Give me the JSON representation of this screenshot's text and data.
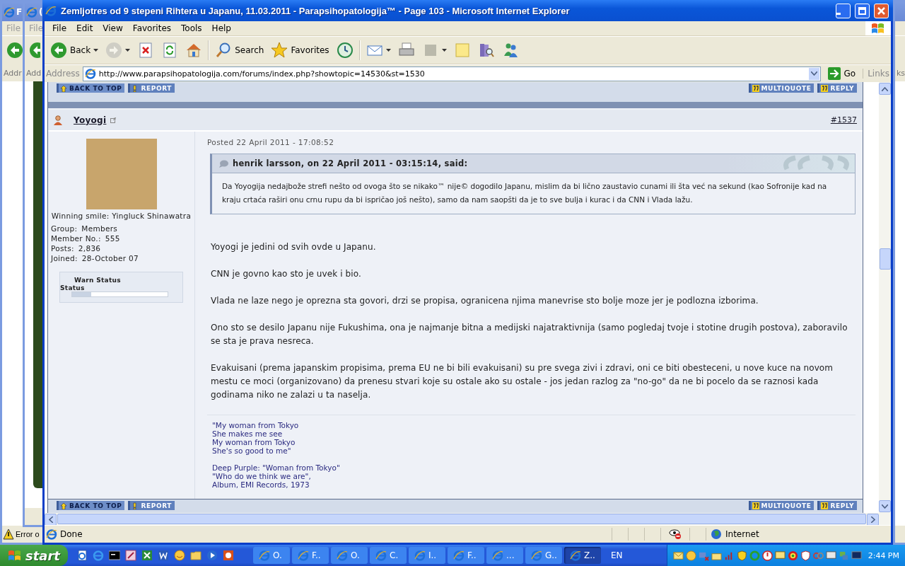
{
  "background_windows": [
    {
      "title": "F",
      "menu": "File",
      "address": "Addr",
      "status": "Error o"
    },
    {
      "title": "(",
      "menu": "File",
      "address": "Add"
    },
    {
      "links": "ks"
    }
  ],
  "window": {
    "title": "Zemljotres od 9 stepeni Rihtera u Japanu, 11.03.2011 - Parapsihopatologija™ - Page 103 - Microsoft Internet Explorer"
  },
  "menu": [
    "File",
    "Edit",
    "View",
    "Favorites",
    "Tools",
    "Help"
  ],
  "toolbar": [
    {
      "kind": "back",
      "label": "Back",
      "dropdown": true,
      "disabled": false
    },
    {
      "kind": "forward",
      "dropdown": true,
      "disabled": true
    },
    {
      "kind": "stop",
      "dropdown": false,
      "disabled": false
    },
    {
      "kind": "refresh",
      "dropdown": false,
      "disabled": false
    },
    {
      "kind": "home",
      "dropdown": false,
      "disabled": false
    },
    {
      "kind": "search",
      "label": "Search",
      "dropdown": false,
      "disabled": false
    },
    {
      "kind": "favorites",
      "label": "Favorites",
      "dropdown": false,
      "disabled": false
    },
    {
      "kind": "history",
      "dropdown": false,
      "disabled": false
    },
    {
      "kind": "mail",
      "dropdown": true,
      "disabled": false
    },
    {
      "kind": "print",
      "dropdown": false,
      "disabled": false
    },
    {
      "kind": "edit",
      "dropdown": true,
      "disabled": true
    },
    {
      "kind": "notes",
      "dropdown": false,
      "disabled": false
    },
    {
      "kind": "research",
      "dropdown": false,
      "disabled": false
    },
    {
      "kind": "messenger",
      "dropdown": false,
      "disabled": false
    }
  ],
  "address": {
    "label": "Address",
    "url": "http://www.parapsihopatologija.com/forums/index.php?showtopic=14530&st=1530",
    "go": "Go",
    "links": "Links"
  },
  "post": {
    "top_buttons": [
      {
        "kind": "top",
        "label": "BACK TO TOP"
      },
      {
        "kind": "report",
        "label": "REPORT"
      },
      {
        "kind": "quote",
        "label": "MULTIQUOTE"
      },
      {
        "kind": "quote",
        "label": "REPLY"
      }
    ],
    "author": "Yoyogi",
    "number": "#1537",
    "avatar_caption": "Winning smile: Yingluck Shinawatra",
    "profile": [
      {
        "label": "Group:",
        "value": "Members"
      },
      {
        "label": "Member No.:",
        "value": "555"
      },
      {
        "label": "Posts:",
        "value": "2,836"
      },
      {
        "label": "Joined:",
        "value": "28-October 07"
      }
    ],
    "warn": {
      "title": "Warn Status",
      "label": "Status",
      "level": 0.2
    },
    "posted": "Posted 22 April 2011 - 17:08:52",
    "quote": {
      "header": "henrik larsson, on 22 April 2011 - 03:15:14, said:",
      "text": "Da Yoyogija nedajbože strefi nešto od ovoga što se nikako™ nije© dogodilo Japanu, mislim da bi lično zaustavio cunami ili šta već na sekund (kao Sofronije kad na kraju crtaća raširi onu crnu rupu da bi ispričao još nešto), samo da nam saopšti da je to sve bulja i kurac i da CNN i Vlada lažu."
    },
    "paragraphs": [
      "Yoyogi je jedini od svih ovde u Japanu.",
      "CNN je govno kao sto je uvek i bio.",
      "Vlada ne laze nego je oprezna sta govori, drzi se propisa, ogranicena njima manevrise sto bolje moze jer je podlozna izborima.",
      "Ono sto se desilo Japanu nije Fukushima, ona je najmanje bitna a medijski najatraktivnija (samo pogledaj tvoje i stotine drugih postova), zaboravilo se sta je prava nesreca.",
      "Evakuisani (prema japanskim propisima, prema EU ne bi bili evakuisani) su pre svega zivi i zdravi, oni ce biti obesteceni, u nove kuce na novom mestu ce moci (organizovano) da prenesu stvari koje su ostale ako su ostale - jos jedan razlog za \"no-go\" da ne bi pocelo da se raznosi kada godinama niko ne zalazi u ta naselja."
    ],
    "signature": [
      {
        "lines": [
          "\"My woman from Tokyo",
          "She makes me see",
          "My woman from Tokyo",
          "She's so good to me\""
        ]
      },
      {
        "lines": [
          "Deep Purple: \"Woman from Tokyo\"",
          "\"Who do we think we are\",",
          "Album, EMI Records, 1973"
        ]
      }
    ],
    "bottom_buttons": [
      {
        "kind": "top",
        "label": "BACK TO TOP"
      },
      {
        "kind": "report",
        "label": "REPORT"
      },
      {
        "kind": "quote",
        "label": "MULTIQUOTE"
      },
      {
        "kind": "quote",
        "label": "REPLY"
      }
    ]
  },
  "status_bar": {
    "text": "Done",
    "zone": "Internet"
  },
  "taskbar": {
    "start": "start",
    "items": [
      {
        "label": "O.",
        "selected": false
      },
      {
        "label": "F..",
        "selected": false
      },
      {
        "label": "O.",
        "selected": false
      },
      {
        "label": "C.",
        "selected": false
      },
      {
        "label": "I..",
        "selected": false
      },
      {
        "label": "F..",
        "selected": false
      },
      {
        "label": "...",
        "selected": false
      },
      {
        "label": "G..",
        "selected": false
      },
      {
        "label": "Z..",
        "selected": true
      }
    ],
    "language": "EN",
    "clock": "2:44 PM"
  }
}
